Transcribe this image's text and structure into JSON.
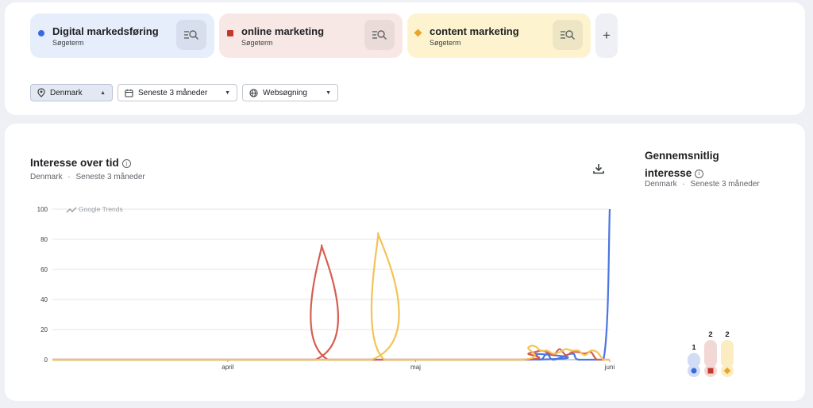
{
  "search_terms": [
    {
      "name": "Digital markedsføring",
      "type": "Søgeterm",
      "color": "#3b6ae0",
      "shape": "circle"
    },
    {
      "name": "online marketing",
      "type": "Søgeterm",
      "color": "#c5392b",
      "shape": "square"
    },
    {
      "name": "content marketing",
      "type": "Søgeterm",
      "color": "#e8a52a",
      "shape": "diamond"
    }
  ],
  "add_term_label": "+",
  "filters": {
    "location": "Denmark",
    "time": "Seneste 3 måneder",
    "search_type": "Websøgning"
  },
  "interest_over_time": {
    "title": "Interesse over tid",
    "location": "Denmark",
    "separator": "·",
    "period": "Seneste 3 måneder",
    "watermark": "Google Trends"
  },
  "average_interest": {
    "title_line1": "Gennemsnitlig",
    "title_line2": "interesse",
    "location": "Denmark",
    "separator": "·",
    "period": "Seneste 3 måneder",
    "values": [
      1,
      2,
      2
    ]
  },
  "chart_data": {
    "type": "line",
    "ylim": [
      0,
      100
    ],
    "yticks": [
      0,
      20,
      40,
      60,
      80,
      100
    ],
    "xlabels": [
      {
        "label": "april",
        "index": 28
      },
      {
        "label": "maj",
        "index": 58
      },
      {
        "label": "juni",
        "index": 89
      }
    ],
    "n_points": 90,
    "series": [
      {
        "name": "Digital markedsføring",
        "color": "#4b75df",
        "points": [
          [
            0,
            0
          ],
          [
            76,
            0
          ],
          [
            77,
            4
          ],
          [
            78,
            0
          ],
          [
            79,
            4
          ],
          [
            80,
            0
          ],
          [
            83,
            4
          ],
          [
            84,
            0
          ],
          [
            88,
            0
          ],
          [
            89,
            100
          ]
        ]
      },
      {
        "name": "online marketing",
        "color": "#d55e50",
        "points": [
          [
            0,
            0
          ],
          [
            42,
            0
          ],
          [
            43,
            76
          ],
          [
            44,
            0
          ],
          [
            75,
            0
          ],
          [
            76,
            4
          ],
          [
            77,
            5
          ],
          [
            78,
            6
          ],
          [
            79,
            5
          ],
          [
            80,
            3
          ],
          [
            81,
            7
          ],
          [
            82,
            3
          ],
          [
            83,
            5
          ],
          [
            84,
            5
          ],
          [
            85,
            4
          ],
          [
            86,
            5
          ],
          [
            87,
            0
          ],
          [
            89,
            0
          ]
        ]
      },
      {
        "name": "content marketing",
        "color": "#f3c354",
        "points": [
          [
            0,
            0
          ],
          [
            51,
            0
          ],
          [
            52,
            84
          ],
          [
            53,
            0
          ],
          [
            75,
            0
          ],
          [
            76,
            8
          ],
          [
            77,
            9
          ],
          [
            78,
            6
          ],
          [
            79,
            6
          ],
          [
            80,
            4
          ],
          [
            81,
            5
          ],
          [
            82,
            7
          ],
          [
            83,
            6
          ],
          [
            84,
            6
          ],
          [
            85,
            3
          ],
          [
            86,
            6
          ],
          [
            87,
            5
          ],
          [
            88,
            0
          ],
          [
            89,
            0
          ]
        ]
      }
    ]
  }
}
